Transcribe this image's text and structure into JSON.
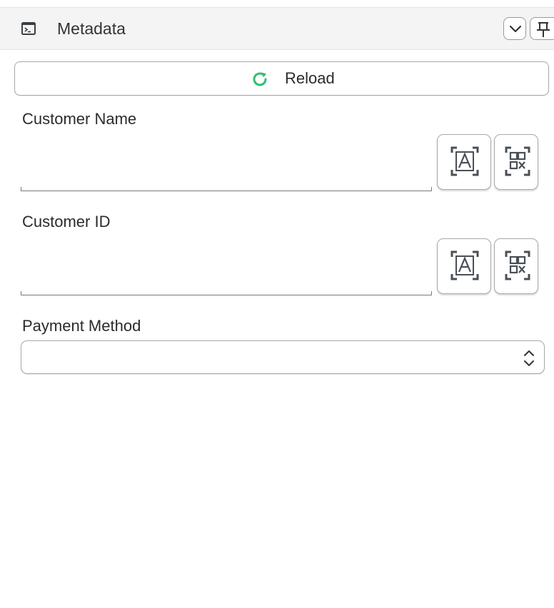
{
  "panel": {
    "title": "Metadata",
    "title_icon": "terminal-window-icon",
    "collapse_icon": "chevron-down-icon",
    "pin_icon": "pin-icon"
  },
  "reload": {
    "label": "Reload",
    "icon": "refresh-icon",
    "icon_color": "#2fbf71"
  },
  "fields": [
    {
      "label": "Customer Name",
      "value": "",
      "ocr_icon": "ocr-text-scan-icon",
      "barcode_icon": "qr-scan-icon"
    },
    {
      "label": "Customer ID",
      "value": "",
      "ocr_icon": "ocr-text-scan-icon",
      "barcode_icon": "qr-scan-icon"
    }
  ],
  "payment": {
    "label": "Payment Method",
    "value": "",
    "arrows_icon": "up-down-chevron-icon"
  },
  "colors": {
    "accent": "#2fbf71",
    "border": "#a8a8a8",
    "header_bg": "#f4f4f4",
    "icon": "#4a4f57"
  }
}
